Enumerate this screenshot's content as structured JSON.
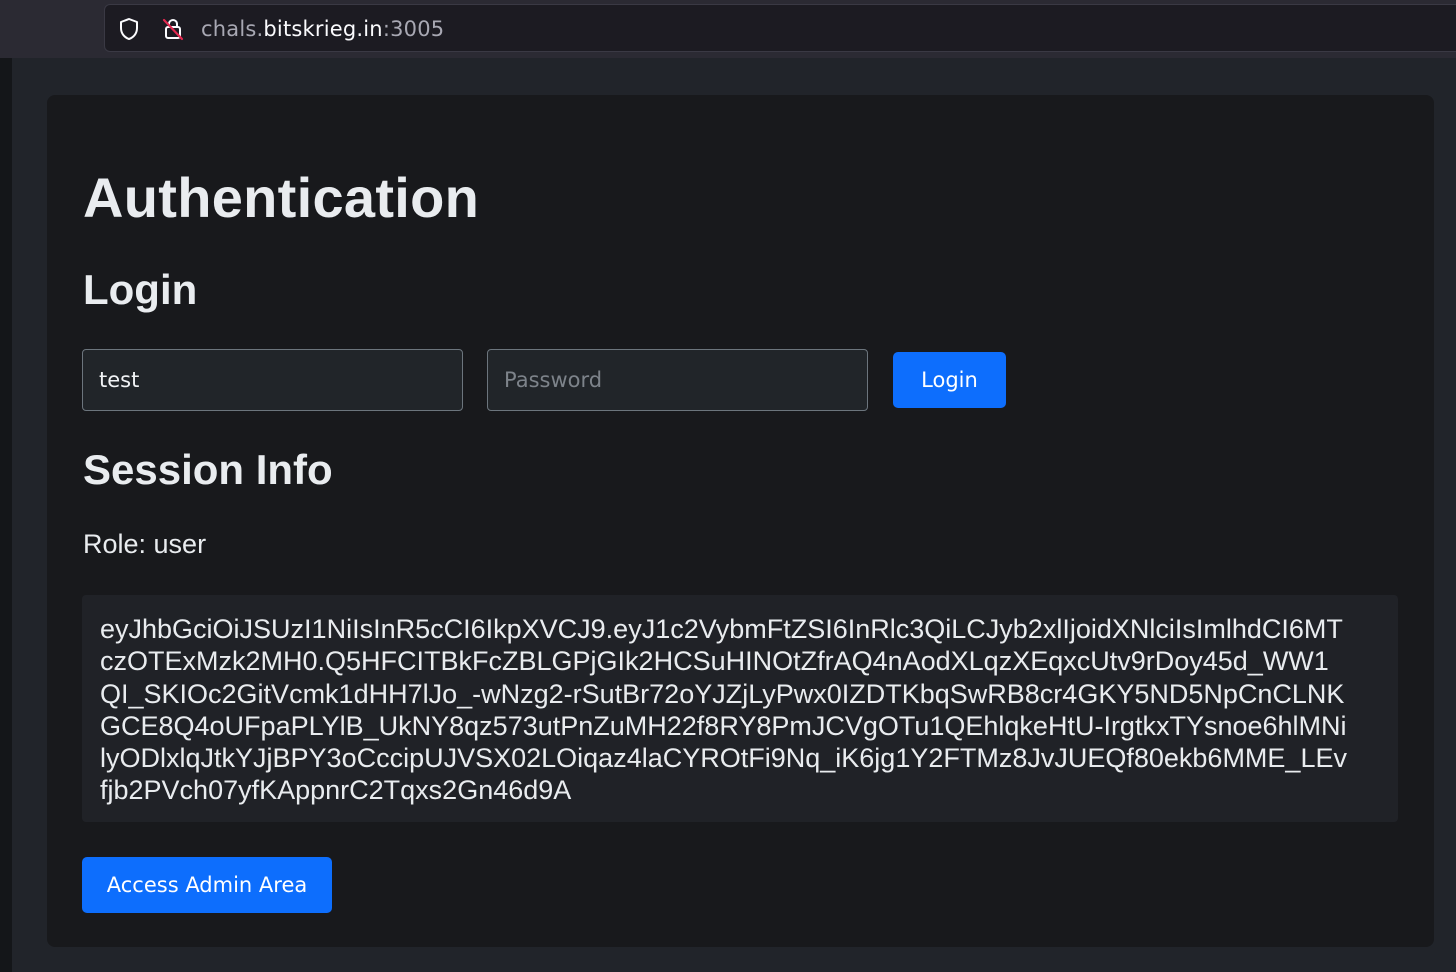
{
  "browser": {
    "url_prefix": "chals.",
    "url_domain": "bitskrieg.in",
    "url_port": ":3005"
  },
  "page": {
    "title": "Authentication",
    "login_heading": "Login",
    "username_value": "test",
    "password_placeholder": "Password",
    "login_button": "Login",
    "session_heading": "Session Info",
    "role_text": "Role: user",
    "token": "eyJhbGciOiJSUzI1NiIsInR5cCI6IkpXVCJ9.eyJ1c2VybmFtZSI6InRlc3QiLCJyb2xlIjoidXNlciIsImlhdCI6MT\nczOTExMzk2MH0.Q5HFCITBkFcZBLGPjGIk2HCSuHINOtZfrAQ4nAodXLqzXEqxcUtv9rDoy45d_WW1\nQI_SKIOc2GitVcmk1dHH7lJo_-wNzg2-rSutBr72oYJZjLyPwx0IZDTKbqSwRB8cr4GKY5ND5NpCnCLNK\nGCE8Q4oUFpaPLYlB_UkNY8qz573utPnZuMH22f8RY8PmJCVgOTu1QEhlqkeHtU-IrgtkxTYsnoe6hlMNi\nlyODlxlqJtkYJjBPY3oCccipUJVSX02LOiqaz4laCYROtFi9Nq_iK6jg1Y2FTMz8JvJUEQf80ekb6MME_LEv\nfjb2PVch07yfKAppnrC2Tqxs2Gn46d9A",
    "admin_button": "Access Admin Area"
  }
}
